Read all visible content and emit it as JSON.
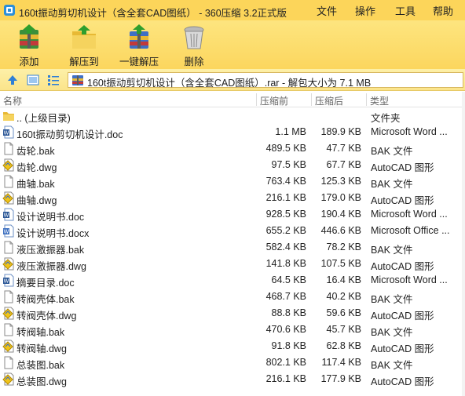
{
  "window": {
    "title": "160t振动剪切机设计（含全套CAD图纸） - 360压缩 3.2正式版",
    "menus": [
      "文件",
      "操作",
      "工具",
      "帮助"
    ]
  },
  "toolbar": {
    "buttons": [
      {
        "label": "添加",
        "icon": "add-archive-icon"
      },
      {
        "label": "解压到",
        "icon": "extract-folder-icon"
      },
      {
        "label": "一键解压",
        "icon": "one-click-extract-icon"
      },
      {
        "label": "删除",
        "icon": "trash-icon"
      }
    ]
  },
  "address": {
    "path": "160t振动剪切机设计（含全套CAD图纸）.rar - 解包大小为 7.1 MB"
  },
  "columns": {
    "name": "名称",
    "packed": "压缩前",
    "unpacked": "压缩后",
    "type": "类型"
  },
  "files": [
    {
      "name": ".. (上级目录)",
      "size": "",
      "packed": "",
      "type": "文件夹",
      "icon": "folder-icon"
    },
    {
      "name": "160t振动剪切机设计.doc",
      "size": "1.1 MB",
      "packed": "189.9 KB",
      "type": "Microsoft Word ...",
      "icon": "word-doc-icon"
    },
    {
      "name": "齿轮.bak",
      "size": "489.5 KB",
      "packed": "47.7 KB",
      "type": "BAK 文件",
      "icon": "blank-file-icon"
    },
    {
      "name": "齿轮.dwg",
      "size": "97.5 KB",
      "packed": "67.7 KB",
      "type": "AutoCAD 图形",
      "icon": "dwg-file-icon"
    },
    {
      "name": "曲轴.bak",
      "size": "763.4 KB",
      "packed": "125.3 KB",
      "type": "BAK 文件",
      "icon": "blank-file-icon"
    },
    {
      "name": "曲轴.dwg",
      "size": "216.1 KB",
      "packed": "179.0 KB",
      "type": "AutoCAD 图形",
      "icon": "dwg-file-icon"
    },
    {
      "name": "设计说明书.doc",
      "size": "928.5 KB",
      "packed": "190.4 KB",
      "type": "Microsoft Word ...",
      "icon": "word-doc-icon"
    },
    {
      "name": "设计说明书.docx",
      "size": "655.2 KB",
      "packed": "446.6 KB",
      "type": "Microsoft Office ...",
      "icon": "word-docx-icon"
    },
    {
      "name": "液压激振器.bak",
      "size": "582.4 KB",
      "packed": "78.2 KB",
      "type": "BAK 文件",
      "icon": "blank-file-icon"
    },
    {
      "name": "液压激振器.dwg",
      "size": "141.8 KB",
      "packed": "107.5 KB",
      "type": "AutoCAD 图形",
      "icon": "dwg-file-icon"
    },
    {
      "name": "摘要目录.doc",
      "size": "64.5 KB",
      "packed": "16.4 KB",
      "type": "Microsoft Word ...",
      "icon": "word-doc-icon"
    },
    {
      "name": "转阀壳体.bak",
      "size": "468.7 KB",
      "packed": "40.2 KB",
      "type": "BAK 文件",
      "icon": "blank-file-icon"
    },
    {
      "name": "转阀壳体.dwg",
      "size": "88.8 KB",
      "packed": "59.6 KB",
      "type": "AutoCAD 图形",
      "icon": "dwg-file-icon"
    },
    {
      "name": "转阀轴.bak",
      "size": "470.6 KB",
      "packed": "45.7 KB",
      "type": "BAK 文件",
      "icon": "blank-file-icon"
    },
    {
      "name": "转阀轴.dwg",
      "size": "91.8 KB",
      "packed": "62.8 KB",
      "type": "AutoCAD 图形",
      "icon": "dwg-file-icon"
    },
    {
      "name": "总装图.bak",
      "size": "802.1 KB",
      "packed": "117.4 KB",
      "type": "BAK 文件",
      "icon": "blank-file-icon"
    },
    {
      "name": "总装图.dwg",
      "size": "216.1 KB",
      "packed": "177.9 KB",
      "type": "AutoCAD 图形",
      "icon": "dwg-file-icon"
    }
  ],
  "colors": {
    "titlebar": "#fcd55a",
    "toolbar": "#fde57f",
    "addressbar": "#fdf0a8",
    "folder": "#e8b934",
    "word_blue": "#2b5797",
    "dwg_yellow": "#f0c419"
  }
}
